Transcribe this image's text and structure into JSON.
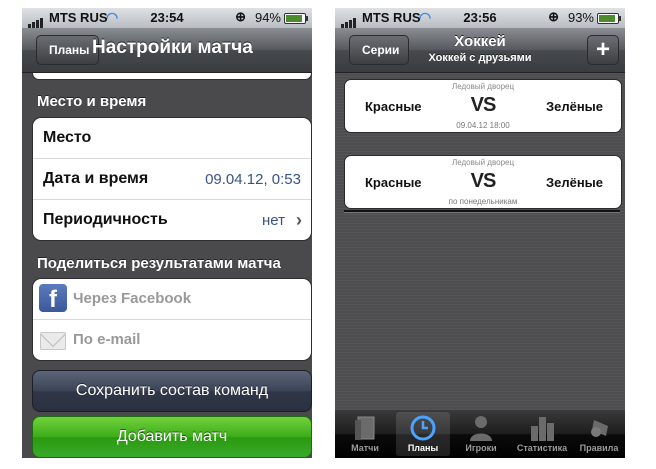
{
  "screen1": {
    "status": {
      "carrier": "MTS RUS",
      "time": "23:54",
      "battery": "94%",
      "battery_level": 0.94
    },
    "nav": {
      "back_label": "Планы",
      "title": "Настройки матча"
    },
    "place_time": {
      "header": "Место и время",
      "rows": [
        {
          "label": "Место",
          "value": ""
        },
        {
          "label": "Дата и время",
          "value": "09.04.12, 0:53"
        },
        {
          "label": "Периодичность",
          "value": "нет"
        }
      ]
    },
    "share": {
      "header": "Поделиться результатами матча",
      "facebook": "Через Facebook",
      "email": "По e-mail"
    },
    "buttons": {
      "save_teams": "Сохранить состав команд",
      "add_match": "Добавить матч"
    },
    "icons": {
      "facebook": "facebook-icon",
      "email": "mail-icon",
      "disclosure": "chevron-right-icon"
    }
  },
  "screen2": {
    "status": {
      "carrier": "MTS RUS",
      "time": "23:56",
      "battery": "93%",
      "battery_level": 0.93
    },
    "nav": {
      "back_label": "Серии",
      "title": "Хоккей",
      "subtitle": "Хоккей с друзьями",
      "add_label": "+"
    },
    "matches": [
      {
        "arena": "Ледовый дворец",
        "team1": "Красные",
        "vs": "VS",
        "team2": "Зелёные",
        "when": "09.04.12 18:00"
      },
      {
        "arena": "Ледовый дворец",
        "team1": "Красные",
        "vs": "VS",
        "team2": "Зелёные",
        "when": "по понедельникам"
      }
    ],
    "tabs": [
      {
        "label": "Матчи",
        "icon": "matches-icon",
        "active": false
      },
      {
        "label": "Планы",
        "icon": "clock-icon",
        "active": true
      },
      {
        "label": "Игроки",
        "icon": "player-icon",
        "active": false
      },
      {
        "label": "Статистика",
        "icon": "stats-icon",
        "active": false
      },
      {
        "label": "Правила",
        "icon": "whistle-icon",
        "active": false
      }
    ]
  },
  "colors": {
    "save_button": "#3b4356",
    "add_button": "#3cac1b",
    "value_text": "#385487"
  }
}
